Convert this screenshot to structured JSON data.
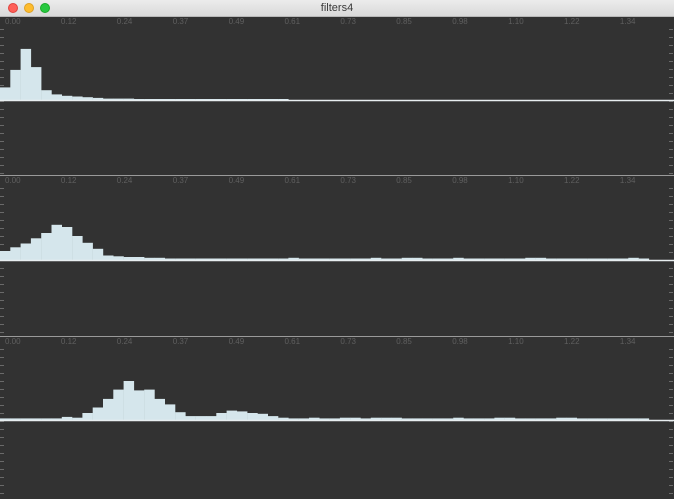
{
  "window": {
    "title": "filters4"
  },
  "axis_ticks": [
    "0.00",
    "0.12",
    "0.24",
    "0.37",
    "0.49",
    "0.61",
    "0.73",
    "0.85",
    "0.98",
    "1.10",
    "1.22",
    "1.34"
  ],
  "colors": {
    "bars": "#d5e6ec",
    "baseline": "#e8eef0",
    "background": "#323232",
    "ticks": "#5f5f5f"
  },
  "chart_data": [
    {
      "type": "bar",
      "values": [
        0.18,
        0.43,
        0.73,
        0.47,
        0.14,
        0.08,
        0.06,
        0.05,
        0.04,
        0.03,
        0.02,
        0.02,
        0.02,
        0.015,
        0.01,
        0.01,
        0.01,
        0.01,
        0.008,
        0.008,
        0.006,
        0.006,
        0.005,
        0.005,
        0.004,
        0.004,
        0.003,
        0.003
      ]
    },
    {
      "type": "bar",
      "values": [
        0.12,
        0.17,
        0.22,
        0.29,
        0.36,
        0.47,
        0.44,
        0.32,
        0.23,
        0.15,
        0.06,
        0.05,
        0.04,
        0.04,
        0.03,
        0.03,
        0.02,
        0.02,
        0.02,
        0.02,
        0.02,
        0.02,
        0.02,
        0.02,
        0.02,
        0.02,
        0.02,
        0.02,
        0.03,
        0.02,
        0.02,
        0.02,
        0.02,
        0.02,
        0.02,
        0.02,
        0.03,
        0.02,
        0.02,
        0.03,
        0.03,
        0.02,
        0.02,
        0.02,
        0.03,
        0.02,
        0.02,
        0.02,
        0.02,
        0.02,
        0.02,
        0.03,
        0.03,
        0.02,
        0.02,
        0.02,
        0.02,
        0.02,
        0.02,
        0.02,
        0.02,
        0.03,
        0.02
      ]
    },
    {
      "type": "bar",
      "values": [
        0.02,
        0.02,
        0.02,
        0.02,
        0.02,
        0.02,
        0.04,
        0.03,
        0.09,
        0.16,
        0.27,
        0.39,
        0.5,
        0.38,
        0.39,
        0.27,
        0.2,
        0.1,
        0.05,
        0.05,
        0.05,
        0.09,
        0.12,
        0.11,
        0.09,
        0.08,
        0.05,
        0.03,
        0.02,
        0.02,
        0.03,
        0.02,
        0.02,
        0.03,
        0.03,
        0.02,
        0.03,
        0.03,
        0.03,
        0.02,
        0.02,
        0.02,
        0.02,
        0.02,
        0.03,
        0.02,
        0.02,
        0.02,
        0.03,
        0.03,
        0.02,
        0.02,
        0.02,
        0.02,
        0.03,
        0.03,
        0.02,
        0.02,
        0.02,
        0.02,
        0.02,
        0.02,
        0.02
      ]
    }
  ]
}
